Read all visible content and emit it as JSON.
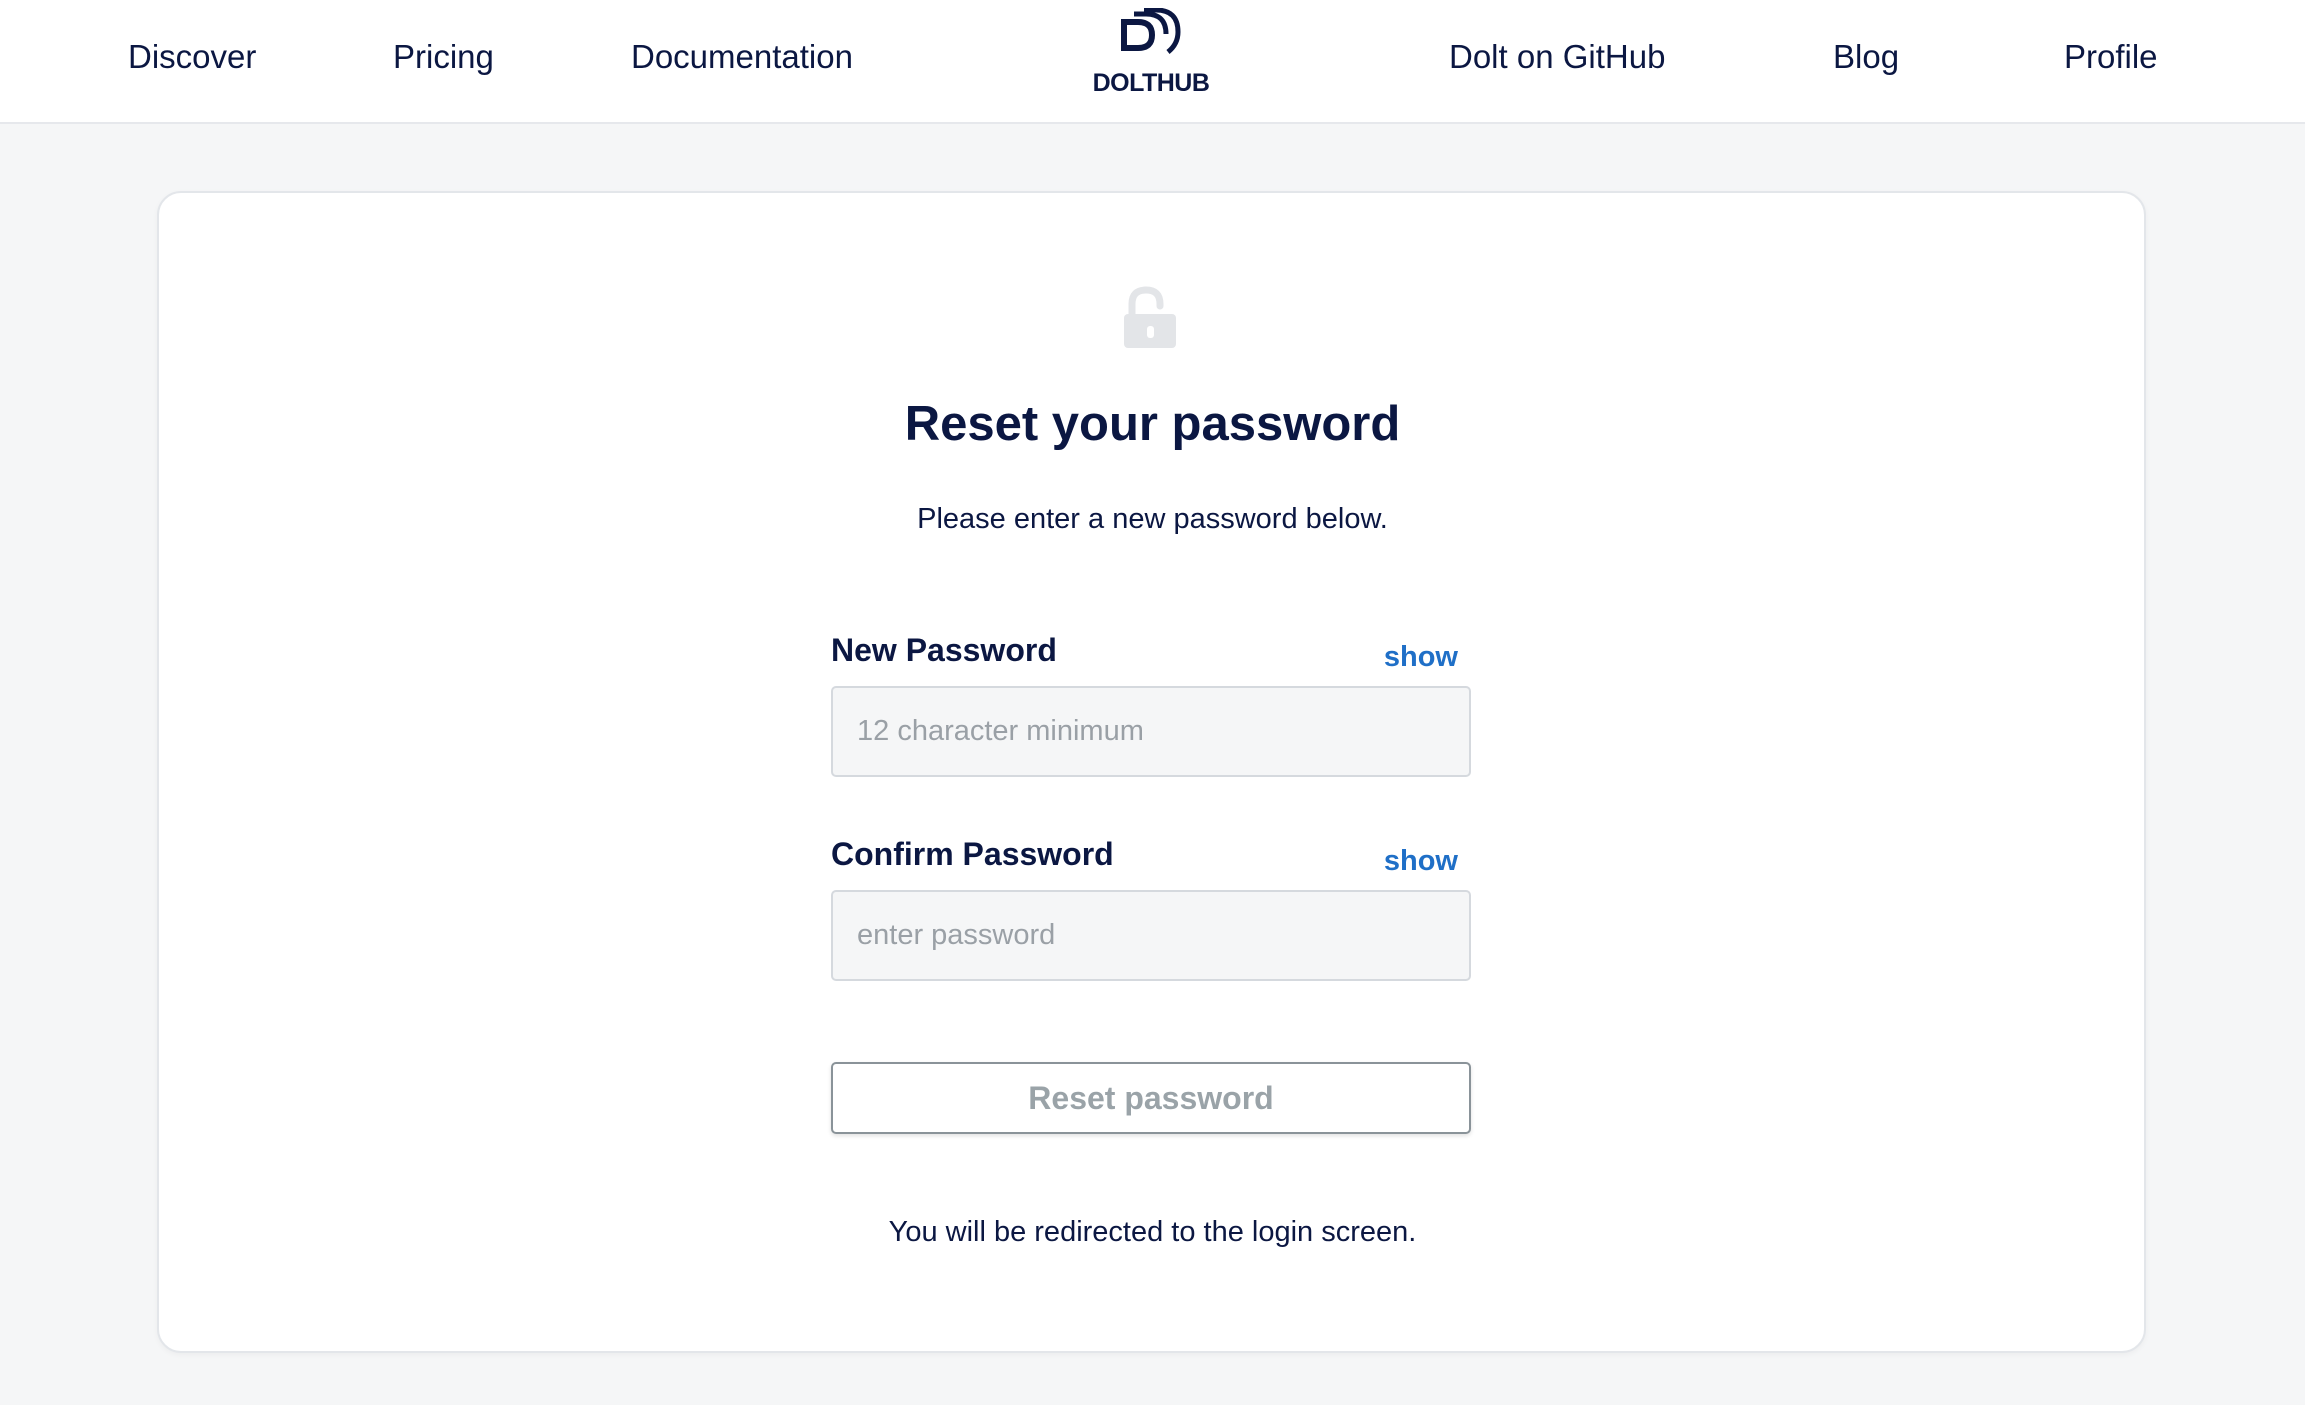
{
  "nav": {
    "discover": "Discover",
    "pricing": "Pricing",
    "documentation": "Documentation",
    "github": "Dolt on GitHub",
    "blog": "Blog",
    "profile": "Profile",
    "logo_text": "DOLTHUB",
    "logo_icon": "dolthub-logo-icon"
  },
  "main": {
    "icon": "unlock-icon",
    "title": "Reset your password",
    "subtitle": "Please enter a new password below.",
    "new_password": {
      "label": "New Password",
      "show_label": "show",
      "value": "",
      "placeholder": "12 character minimum"
    },
    "confirm_password": {
      "label": "Confirm Password",
      "show_label": "show",
      "value": "",
      "placeholder": "enter password"
    },
    "reset_button_label": "Reset password",
    "redirect_note": "You will be redirected to the login screen."
  },
  "colors": {
    "brand_navy": "#0b1742",
    "link_blue": "#1f6fc7",
    "page_background": "#f5f6f7",
    "disabled_text": "#9aa3a8"
  }
}
